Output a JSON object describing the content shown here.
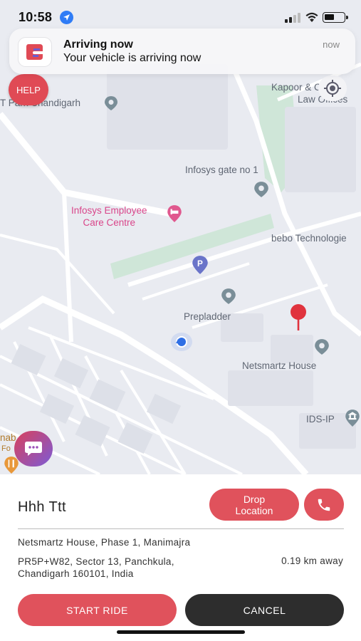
{
  "status_bar": {
    "time": "10:58"
  },
  "notification": {
    "title": "Arriving now",
    "body": "Your vehicle  is arriving now",
    "time": "now"
  },
  "map": {
    "help_label": "HELP",
    "labels": {
      "it_park": "T Park Chandigarh",
      "kapoor": "Kapoor & Co",
      "law_offices": "Law Offices",
      "infosys_gate": "Infosys gate no 1",
      "infosys_care_1": "Infosys Employee",
      "infosys_care_2": "Care Centre",
      "bebo": "bebo Technologie",
      "prepladder": "Prepladder",
      "netsmartz": "Netsmartz House",
      "ids_ip": "IDS-IP",
      "left_edge_1": "nab",
      "left_edge_2": "Fo"
    },
    "icons": [
      "location-arrow-icon",
      "recenter-icon",
      "chat-icon",
      "parking-icon",
      "hotel-icon",
      "restaurant-icon",
      "museum-icon",
      "dest-pin-icon"
    ],
    "colors": {
      "map_bg": "#e9ebf1",
      "road": "#ffffff",
      "park": "#cfe6d8",
      "poi_pin": "#6f8591",
      "dest_pin": "#e0333e"
    }
  },
  "ride": {
    "driver_name": "Hhh Ttt",
    "drop_location_label": "Drop\nLocation",
    "pickup_line1": "Netsmartz House, Phase 1, Manimajra",
    "pickup_line2": "PR5P+W82, Sector 13, Panchkula,\nChandigarh 160101, India",
    "distance": "0.19 km away",
    "start_label": "START RIDE",
    "cancel_label": "CANCEL"
  },
  "colors": {
    "accent": "#e0525c",
    "dark_button": "#2d2d2d"
  }
}
